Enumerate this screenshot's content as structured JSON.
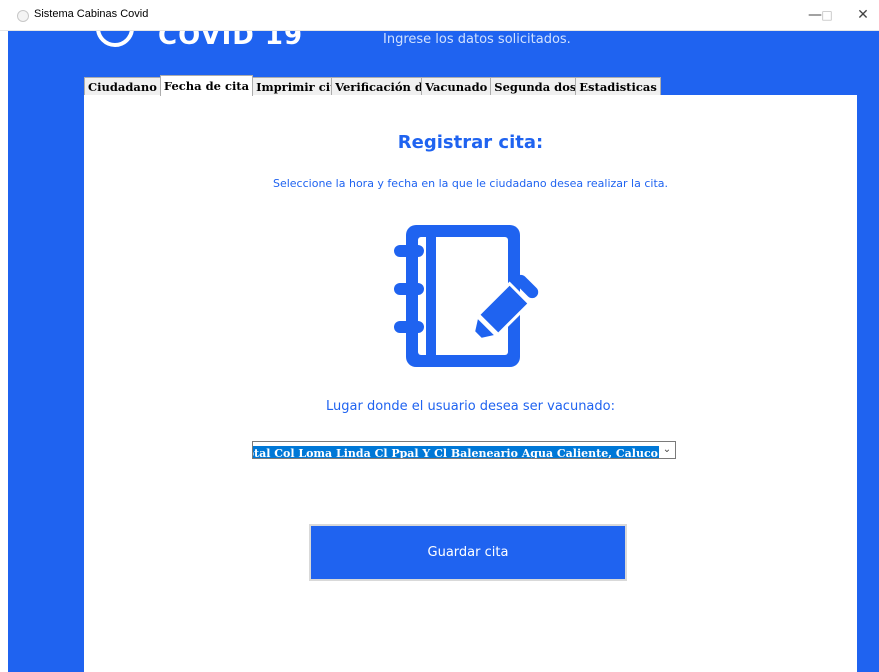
{
  "window": {
    "title": "Sistema Cabinas Covid",
    "controls": {
      "minimize": "—",
      "maximize": "□",
      "close": "✕"
    }
  },
  "header": {
    "logo_text": "COVID 19",
    "subtitle": "Ingrese los datos solicitados."
  },
  "tabs": [
    {
      "label": "Ciudadano",
      "active": false
    },
    {
      "label": "Fecha de cita",
      "active": true
    },
    {
      "label": "Imprimir cita",
      "active": false
    },
    {
      "label": "Verificación d",
      "active": false
    },
    {
      "label": "Vacunado",
      "active": false
    },
    {
      "label": "Segunda dosi",
      "active": false
    },
    {
      "label": "Estadisticas",
      "active": false
    }
  ],
  "form": {
    "heading": "Registrar cita:",
    "instructions": "Seleccione la hora y fecha en la que le ciudadano desea realizar la cita.",
    "place_label": "Lugar donde el usuario desea ser vacunado:",
    "place_selected": "Hosiptal Col Loma Linda Cl Ppal Y Cl Baleneario Agua Caliente, Caluco",
    "save_label": "Guardar cita"
  },
  "colors": {
    "primary": "#1f63f0",
    "selection": "#0078d7",
    "background": "#ffffff"
  },
  "icons": {
    "notebook": "notebook-pencil-icon",
    "dropdown": "chevron-down-icon"
  }
}
